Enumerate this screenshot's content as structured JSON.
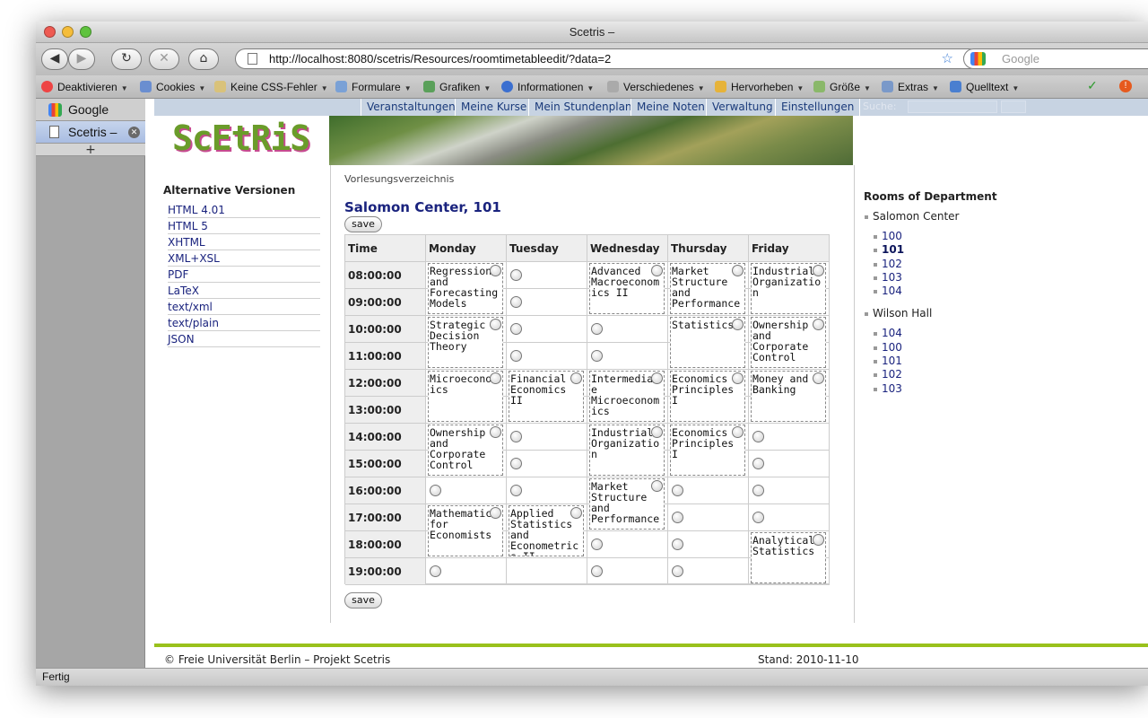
{
  "window": {
    "title": "Scetris –"
  },
  "browser": {
    "url": "http://localhost:8080/scetris/Resources/roomtimetableedit/?data=2",
    "search_placeholder": "Google",
    "status": "Fertig"
  },
  "toolbar": {
    "items": [
      "Deaktivieren",
      "Cookies",
      "Keine CSS-Fehler",
      "Formulare",
      "Grafiken",
      "Informationen",
      "Verschiedenes",
      "Hervorheben",
      "Größe",
      "Extras",
      "Quelltext"
    ]
  },
  "sidebar": {
    "tabs": [
      {
        "label": "Google"
      },
      {
        "label": "Scetris –"
      }
    ],
    "add_label": "+"
  },
  "site": {
    "logo": "ScEtRiS",
    "nav": [
      "Veranstaltungen",
      "Meine Kurse",
      "Mein Stundenplan",
      "Meine Noten",
      "Verwaltung",
      "Einstellungen"
    ],
    "search_label": "Suche:"
  },
  "left": {
    "heading": "Alternative Versionen",
    "links": [
      "HTML 4.01",
      "HTML 5",
      "XHTML",
      "XML+XSL",
      "PDF",
      "LaTeX",
      "text/xml",
      "text/plain",
      "JSON"
    ]
  },
  "main": {
    "breadcrumb": "Vorlesungsverzeichnis",
    "room_title": "Salomon Center, 101",
    "save_label": "save",
    "table": {
      "time_header": "Time",
      "days": [
        "Monday",
        "Tuesday",
        "Wednesday",
        "Thursday",
        "Friday"
      ],
      "times": [
        "08:00:00",
        "09:00:00",
        "10:00:00",
        "11:00:00",
        "12:00:00",
        "13:00:00",
        "14:00:00",
        "15:00:00",
        "16:00:00",
        "17:00:00",
        "18:00:00",
        "19:00:00"
      ],
      "courses": [
        {
          "day": 0,
          "start": 0,
          "rows": 2,
          "title": "Regression and Forecasting Models"
        },
        {
          "day": 0,
          "start": 2,
          "rows": 2,
          "title": "Strategic Decision Theory"
        },
        {
          "day": 0,
          "start": 4,
          "rows": 2,
          "title": "Microeconomics"
        },
        {
          "day": 0,
          "start": 6,
          "rows": 2,
          "title": "Ownership and Corporate Control"
        },
        {
          "day": 0,
          "start": 9,
          "rows": 2,
          "title": "Mathematics for Economists"
        },
        {
          "day": 1,
          "start": 4,
          "rows": 2,
          "title": "Financial Economics II"
        },
        {
          "day": 1,
          "start": 9,
          "rows": 3,
          "title": "Applied Statistics and Econometrics II"
        },
        {
          "day": 2,
          "start": 0,
          "rows": 2,
          "title": "Advanced Macroeconomics II"
        },
        {
          "day": 2,
          "start": 4,
          "rows": 2,
          "title": "Intermediate Microeconomics"
        },
        {
          "day": 2,
          "start": 6,
          "rows": 2,
          "title": "Industrial Organization"
        },
        {
          "day": 2,
          "start": 8,
          "rows": 2,
          "title": "Market Structure and Performance"
        },
        {
          "day": 3,
          "start": 0,
          "rows": 2,
          "title": "Market Structure and Performance"
        },
        {
          "day": 3,
          "start": 2,
          "rows": 2,
          "title": "Statistics"
        },
        {
          "day": 3,
          "start": 4,
          "rows": 2,
          "title": "Economics Principles I"
        },
        {
          "day": 3,
          "start": 6,
          "rows": 2,
          "title": "Economics Principles I"
        },
        {
          "day": 4,
          "start": 0,
          "rows": 2,
          "title": "Industrial Organization"
        },
        {
          "day": 4,
          "start": 2,
          "rows": 2,
          "title": "Ownership and Corporate Control"
        },
        {
          "day": 4,
          "start": 4,
          "rows": 2,
          "title": "Money and Banking"
        },
        {
          "day": 4,
          "start": 10,
          "rows": 2,
          "title": "Analytical Statistics"
        }
      ]
    }
  },
  "right": {
    "heading": "Rooms of Department",
    "buildings": [
      {
        "name": "Salomon Center",
        "rooms": [
          "100",
          "101",
          "102",
          "103",
          "104"
        ],
        "current": "101"
      },
      {
        "name": "Wilson Hall",
        "rooms": [
          "104",
          "100",
          "101",
          "102",
          "103"
        ],
        "current": ""
      }
    ]
  },
  "footer": {
    "copyright": "© Freie Universität Berlin – Projekt Scetris",
    "date": "Stand: 2010-11-10"
  }
}
